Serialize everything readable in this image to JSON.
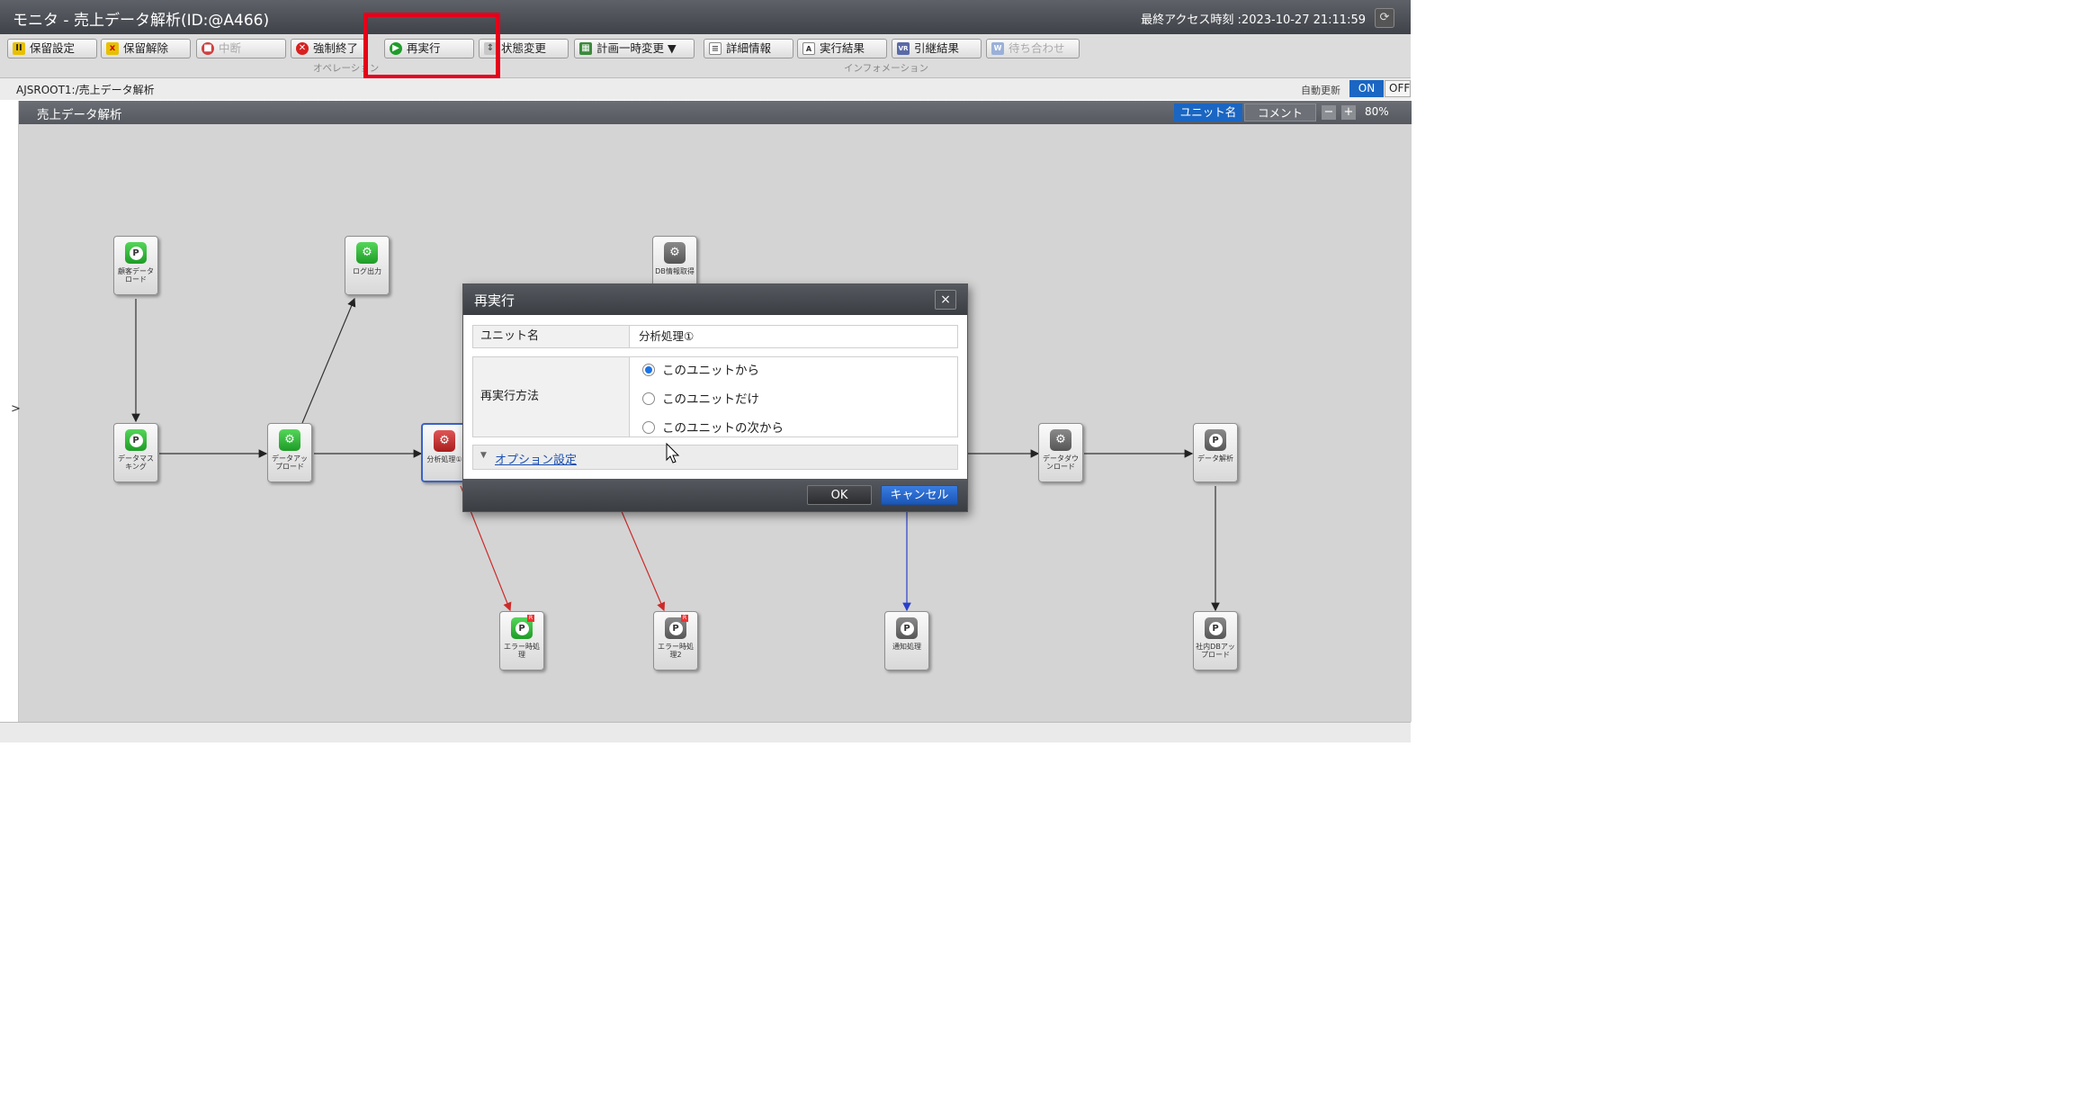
{
  "window": {
    "title": "モニタ - 売上データ解析(ID:@A466)",
    "last_access": "最終アクセス時刻 :2023-10-27 21:11:59"
  },
  "toolbar": {
    "buttons": [
      {
        "label": "保留設定",
        "icon": "pause-icon"
      },
      {
        "label": "保留解除",
        "icon": "hold-release-icon"
      },
      {
        "label": "中断",
        "icon": "stop-icon",
        "disabled": true
      },
      {
        "label": "強制終了",
        "icon": "force-end-icon"
      },
      {
        "label": "再実行",
        "icon": "rerun-icon"
      },
      {
        "label": "状態変更",
        "icon": "status-change-icon"
      },
      {
        "label": "計画一時変更 ▼",
        "icon": "schedule-icon"
      },
      {
        "label": "詳細情報",
        "icon": "detail-icon"
      },
      {
        "label": "実行結果",
        "icon": "result-icon"
      },
      {
        "label": "引継結果",
        "icon": "inherit-result-icon"
      },
      {
        "label": "待ち合わせ",
        "icon": "wait-icon",
        "disabled": true
      }
    ],
    "group_operation": "オペレーション",
    "group_information": "インフォメーション"
  },
  "pathbar": {
    "path": "AJSROOT1:/売上データ解析",
    "auto_update_label": "自動更新",
    "toggle_on": "ON",
    "toggle_off": "OFF"
  },
  "canvas": {
    "jobnet_name": "売上データ解析",
    "view_unit": "ユニット名",
    "view_comment": "コメント",
    "zoom_out": "−",
    "zoom_in": "+",
    "zoom": "80%",
    "side_arrow": ">"
  },
  "nodes": [
    {
      "label": "顧客データロード",
      "icon": "p-icon"
    },
    {
      "label": "ログ出力",
      "icon": "job-icon"
    },
    {
      "label": "DB情報取得",
      "icon": "job-icon"
    },
    {
      "label": "データマスキング",
      "icon": "p-icon"
    },
    {
      "label": "データアップロード",
      "icon": "job-icon"
    },
    {
      "label": "分析処理①",
      "icon": "job-icon"
    },
    {
      "label": "データダウンロード",
      "icon": "job-icon"
    },
    {
      "label": "データ解析",
      "icon": "p-icon"
    },
    {
      "label": "エラー時処理",
      "icon": "p-icon"
    },
    {
      "label": "エラー時処理2",
      "icon": "p-icon"
    },
    {
      "label": "通知処理",
      "icon": "p-icon"
    },
    {
      "label": "社内DBアップロード",
      "icon": "p-icon"
    }
  ],
  "dialog": {
    "title": "再実行",
    "close": "×",
    "unit_name_label": "ユニット名",
    "unit_name_value": "分析処理①",
    "method_label": "再実行方法",
    "options": [
      {
        "label": "このユニットから",
        "selected": true
      },
      {
        "label": "このユニットだけ",
        "selected": false
      },
      {
        "label": "このユニットの次から",
        "selected": false
      }
    ],
    "option_settings": "オプション設定",
    "ok": "OK",
    "cancel": "キャンセル"
  },
  "colors": {
    "accent": "#1a66c2",
    "highlight": "#e5001a",
    "error_edge": "#cc2a2a",
    "notify_edge": "#2a3ecc"
  }
}
